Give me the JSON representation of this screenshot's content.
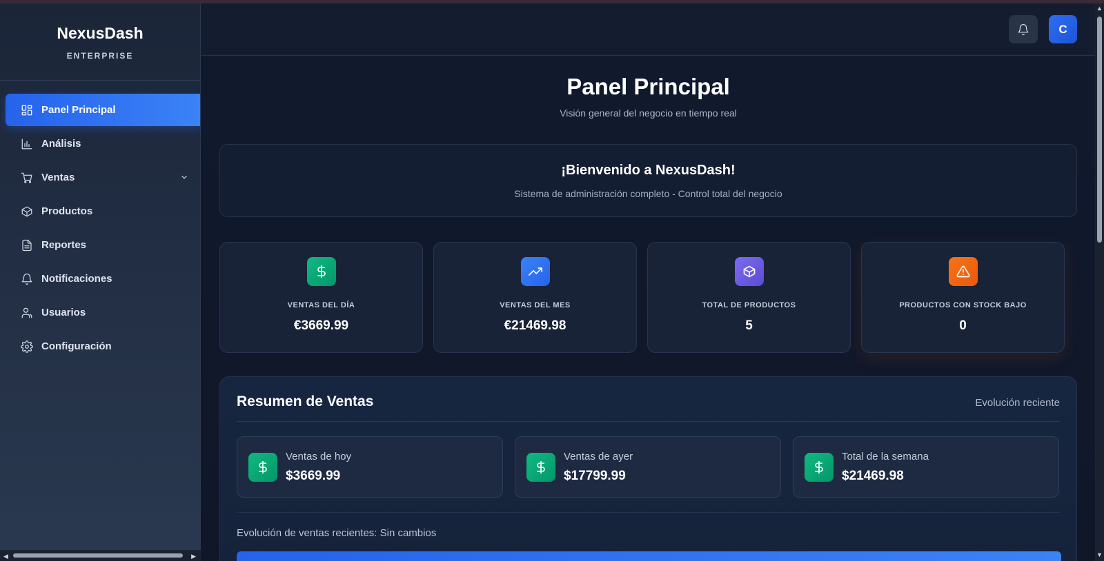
{
  "brand": {
    "name": "NexusDash",
    "subtitle": "ENTERPRISE"
  },
  "sidebar": {
    "items": [
      {
        "label": "Panel Principal",
        "icon": "dashboard-icon",
        "active": true
      },
      {
        "label": "Análisis",
        "icon": "bar-chart-icon"
      },
      {
        "label": "Ventas",
        "icon": "cart-icon",
        "expandable": true
      },
      {
        "label": "Productos",
        "icon": "box-icon"
      },
      {
        "label": "Reportes",
        "icon": "document-icon"
      },
      {
        "label": "Notificaciones",
        "icon": "bell-icon"
      },
      {
        "label": "Usuarios",
        "icon": "users-icon"
      },
      {
        "label": "Configuración",
        "icon": "gear-icon"
      }
    ]
  },
  "header": {
    "avatar_initial": "C",
    "notification_icon": "bell-icon"
  },
  "page": {
    "title": "Panel Principal",
    "subtitle": "Visión general del negocio en tiempo real"
  },
  "welcome": {
    "title": "¡Bienvenido a NexusDash!",
    "subtitle": "Sistema de administración completo - Control total del negocio"
  },
  "stats": [
    {
      "label": "VENTAS DEL DÍA",
      "value": "€3669.99",
      "icon": "dollar-icon",
      "color": "#10b981"
    },
    {
      "label": "VENTAS DEL MES",
      "value": "€21469.98",
      "icon": "trending-up-icon",
      "color": "#3b82f6"
    },
    {
      "label": "TOTAL DE PRODUCTOS",
      "value": "5",
      "icon": "box-icon",
      "color": "#6d5ce8"
    },
    {
      "label": "PRODUCTOS CON STOCK BAJO",
      "value": "0",
      "icon": "alert-icon",
      "color": "#f97316"
    }
  ],
  "summary": {
    "title": "Resumen de Ventas",
    "link": "Evolución reciente",
    "cards": [
      {
        "label": "Ventas de hoy",
        "value": "$3669.99",
        "icon": "dollar-icon"
      },
      {
        "label": "Ventas de ayer",
        "value": "$17799.99",
        "icon": "dollar-icon"
      },
      {
        "label": "Total de la semana",
        "value": "$21469.98",
        "icon": "dollar-icon"
      }
    ],
    "evolution_text": "Evolución de ventas recientes: Sin cambios"
  },
  "colors": {
    "accent": "#2563eb",
    "success": "#10b981",
    "warning": "#f97316",
    "purple": "#6d5ce8"
  }
}
